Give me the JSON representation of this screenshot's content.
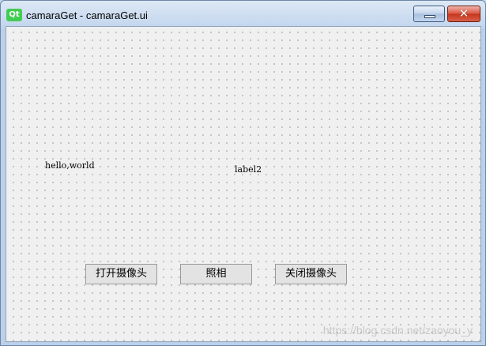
{
  "window": {
    "title": "camaraGet - camaraGet.ui",
    "icon_label": "Qt",
    "icon_color": "#41cd52"
  },
  "form": {
    "label1": "hello,world",
    "label2": "label2",
    "buttons": {
      "open_camera": "打开摄像头",
      "take_photo": "照相",
      "close_camera": "关闭摄像头"
    }
  },
  "watermark": "https://blog.csdn.net/zaoyou_y"
}
